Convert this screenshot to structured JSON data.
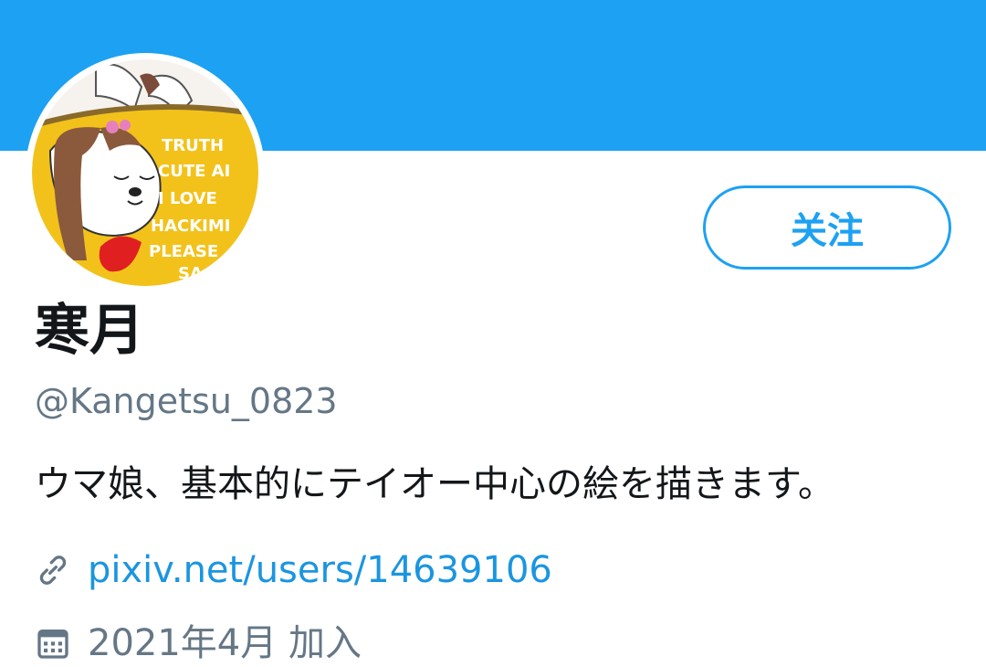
{
  "header": {
    "banner_color": "#1da1f2"
  },
  "profile": {
    "avatar": "avatar-image",
    "follow_label": "关注",
    "display_name": "寒月",
    "handle": "@Kangetsu_0823",
    "bio": "ウマ娘、基本的にテイオー中心の絵を描きます。",
    "website": {
      "icon": "link-icon",
      "text": "pixiv.net/users/14639106"
    },
    "joined": {
      "icon": "calendar-icon",
      "text": "2021年4月 加入"
    }
  },
  "colors": {
    "accent": "#1da1f2",
    "link": "#1b95e0",
    "secondary_text": "#657786",
    "primary_text": "#14171a"
  }
}
